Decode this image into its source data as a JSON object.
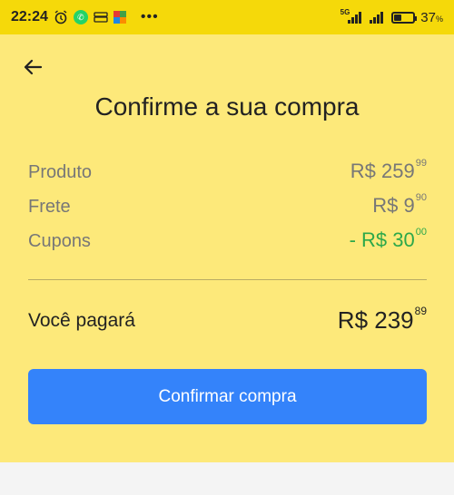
{
  "status_bar": {
    "time": "22:24",
    "network_label": "5G",
    "battery_percent": "37",
    "battery_unit": "%",
    "battery_level": 0.37,
    "more": "•••",
    "icons": [
      "alarm-icon",
      "whatsapp-icon",
      "stack-icon",
      "app-icon",
      "signal-icon",
      "battery-icon"
    ]
  },
  "header": {
    "back_icon": "arrow-left-icon",
    "title": "Confirme a sua compra"
  },
  "summary": {
    "product": {
      "label": "Produto",
      "amount": "R$ 259",
      "cents": "99"
    },
    "shipping": {
      "label": "Frete",
      "amount": "R$ 9",
      "cents": "90"
    },
    "coupons": {
      "label": "Cupons",
      "amount": "- R$ 30",
      "cents": "00"
    }
  },
  "total": {
    "label": "Você pagará",
    "amount": "R$ 239",
    "cents": "89"
  },
  "actions": {
    "confirm_label": "Confirmar compra"
  },
  "colors": {
    "status_bar": "#f5d90a",
    "panel": "#fde97a",
    "button": "#3483fa",
    "discount": "#2ca84a"
  }
}
